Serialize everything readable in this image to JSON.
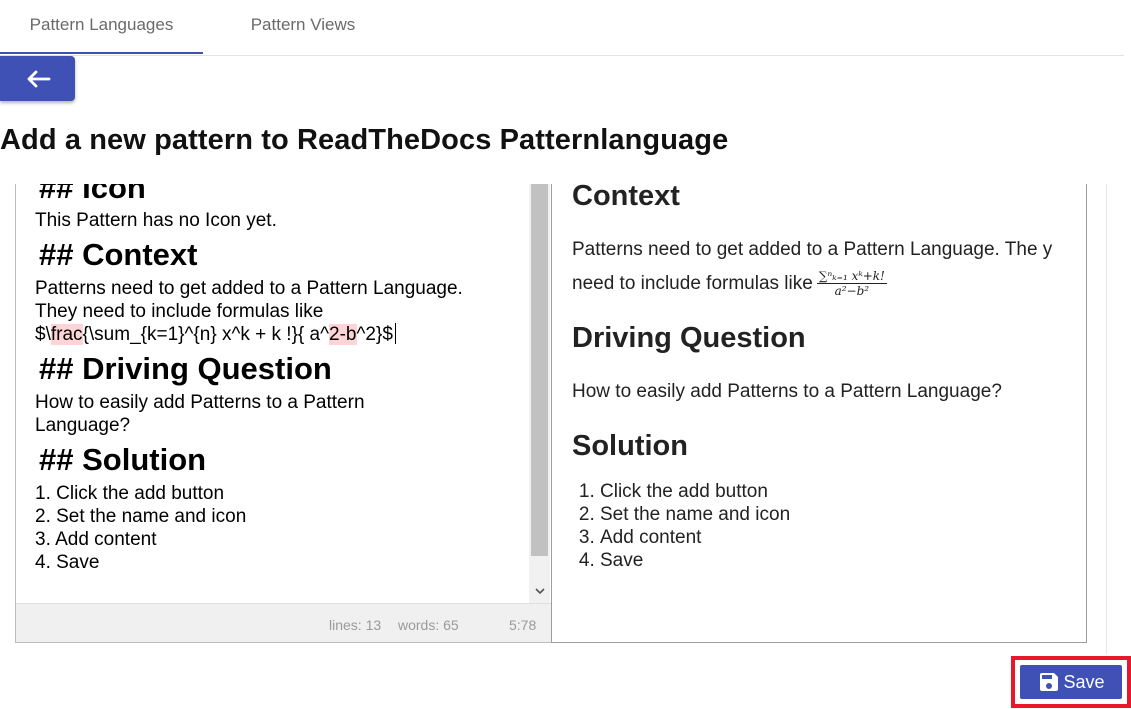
{
  "tabs": [
    {
      "label": "Pattern Languages",
      "active": true
    },
    {
      "label": "Pattern Views",
      "active": false
    }
  ],
  "back_button": {
    "icon": "arrow-left-icon"
  },
  "page_title": "Add a new pattern to ReadTheDocs Patternlanguage",
  "editor": {
    "partial_heading": "## Icon",
    "icon_text": "This Pattern has no Icon yet.",
    "context_heading": "## Context",
    "context_line1": "Patterns need to get added to a Pattern Language.",
    "context_line2": "They need to include formulas like",
    "formula_a": "$\\",
    "formula_b": "frac",
    "formula_c": "{\\sum_{k=1}^{n} x^k + k !}{ a^",
    "formula_d": "2-b",
    "formula_e": "^2}$",
    "driving_heading": "## Driving Question",
    "driving_line1": "How to easily add Patterns to a Pattern",
    "driving_line2": "Language?",
    "solution_heading": "## Solution",
    "list": [
      "1. Click the add button",
      "2. Set the name and icon",
      "3. Add content",
      "4. Save"
    ]
  },
  "statusbar": {
    "lines": "lines: 13",
    "words": "words: 65",
    "cursor": "5:78"
  },
  "preview": {
    "context_heading": "Context",
    "context_text": "Patterns need to get added to a Pattern Language. The y need to include formulas like",
    "formula_num": "∑ⁿₖ₌₁ xᵏ+k!",
    "formula_den": "a²−b²",
    "driving_heading": "Driving Question",
    "driving_text": "How to easily add Patterns to a Pattern Language?",
    "solution_heading": "Solution",
    "list": [
      "Click the add button",
      "Set the name and icon",
      "Add content",
      "Save"
    ]
  },
  "save_button": {
    "label": "Save",
    "icon": "floppy-disk-icon"
  },
  "colors": {
    "primary": "#3f51b5",
    "highlight_border": "#e8172b",
    "error_highlight": "#ffd4d6"
  }
}
